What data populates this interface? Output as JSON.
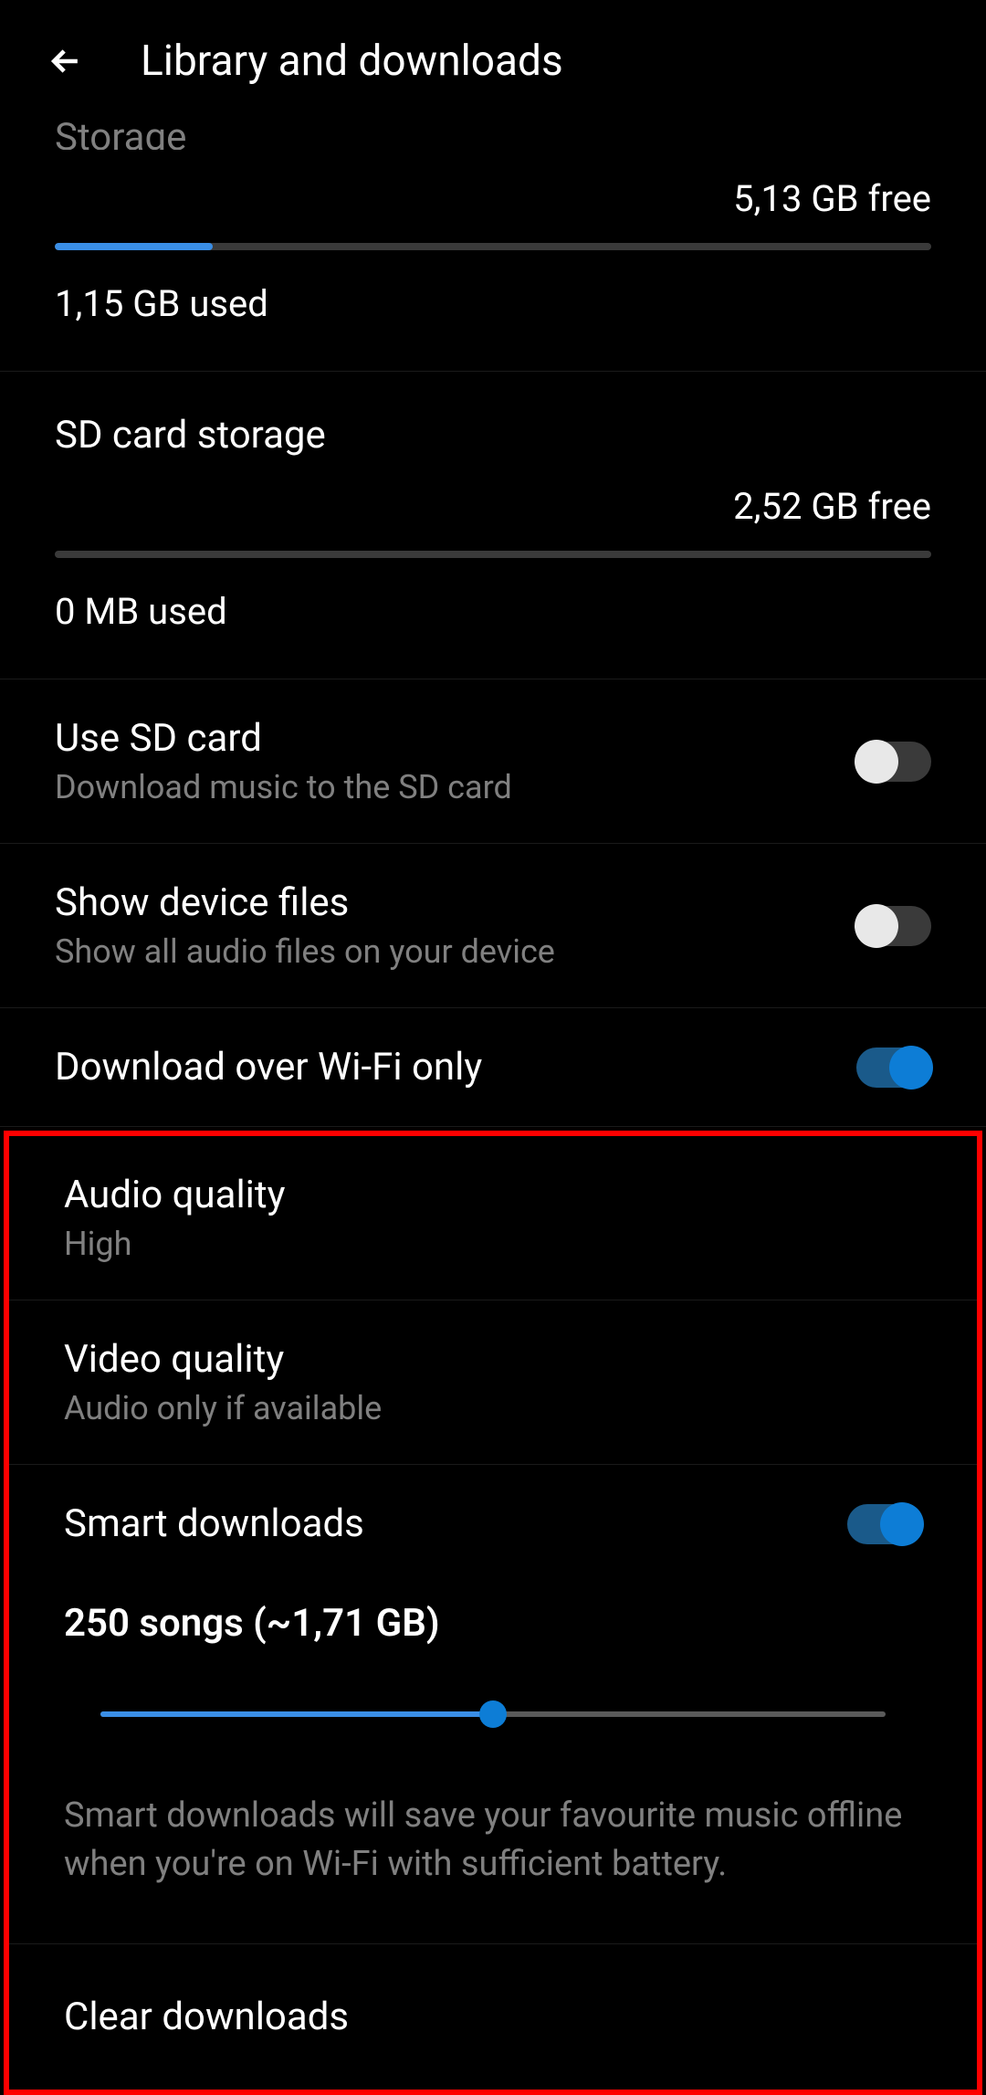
{
  "header": {
    "title": "Library and downloads"
  },
  "storage": {
    "title": "Storage",
    "free": "5,13 GB free",
    "used": "1,15 GB used",
    "fillPercent": 18
  },
  "sdStorage": {
    "title": "SD card storage",
    "free": "2,52 GB free",
    "used": "0 MB used",
    "fillPercent": 0
  },
  "useSdCard": {
    "title": "Use SD card",
    "subtitle": "Download music to the SD card",
    "toggled": false
  },
  "showDeviceFiles": {
    "title": "Show device files",
    "subtitle": "Show all audio files on your device",
    "toggled": false
  },
  "wifiOnly": {
    "title": "Download over Wi-Fi only",
    "toggled": true
  },
  "audioQuality": {
    "title": "Audio quality",
    "value": "High"
  },
  "videoQuality": {
    "title": "Video quality",
    "value": "Audio only if available"
  },
  "smartDownloads": {
    "title": "Smart downloads",
    "toggled": true,
    "info": "250 songs (~1,71 GB)",
    "sliderPercent": 50,
    "description": "Smart downloads will save your favourite music offline when you're on Wi-Fi with sufficient battery."
  },
  "clearDownloads": {
    "title": "Clear downloads"
  }
}
